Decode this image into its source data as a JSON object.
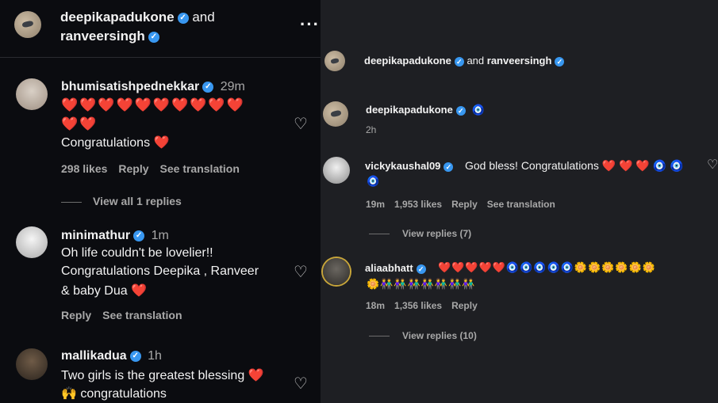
{
  "left": {
    "header": {
      "user1": "deepikapadukone",
      "connector": "and",
      "user2": "ranveersingh",
      "menu_icon": "ellipsis-icon"
    },
    "comments": [
      {
        "username": "bhumisatishpednekkar",
        "time": "29m",
        "line1": "❤️❤️❤️❤️❤️❤️❤️❤️❤️❤️",
        "line2": "❤️❤️",
        "line3": "Congratulations ❤️",
        "likes": "298 likes",
        "reply": "Reply",
        "translate": "See translation",
        "view_replies": "View all 1 replies"
      },
      {
        "username": "minimathur",
        "time": "1m",
        "line1": "Oh life couldn't be lovelier!!",
        "line2": "Congratulations Deepika , Ranveer",
        "line3": "& baby Dua ❤️",
        "reply": "Reply",
        "translate": "See translation"
      },
      {
        "username": "mallikadua",
        "time": "1h",
        "line1": "Two girls is the greatest blessing ❤️",
        "line2": "🙌 congratulations"
      }
    ]
  },
  "right": {
    "header": {
      "user1": "deepikapadukone",
      "connector": "and",
      "user2": "ranveersingh"
    },
    "caption": {
      "username": "deepikapadukone",
      "emoji": "🧿",
      "time": "2h"
    },
    "comments": [
      {
        "username": "vickykaushal09",
        "text": "God bless! Congratulations ❤️ ❤️ ❤️ 🧿 🧿",
        "text2": "🧿",
        "time": "19m",
        "likes": "1,953 likes",
        "reply": "Reply",
        "translate": "See translation",
        "view_replies": "View replies (7)"
      },
      {
        "username": "aliaabhatt",
        "text": "❤️❤️❤️❤️❤️🧿🧿🧿🧿🧿🌼🌼🌼🌼🌼🌼",
        "text2": "🌼👫👫👫👫👫👫👫",
        "time": "18m",
        "likes": "1,356 likes",
        "reply": "Reply",
        "view_replies": "View replies (10)"
      }
    ]
  },
  "colors": {
    "left_bg": "#0b0c10",
    "right_bg": "#1e1f23",
    "verified": "#3897f0",
    "heart": "#ff3f5c"
  }
}
